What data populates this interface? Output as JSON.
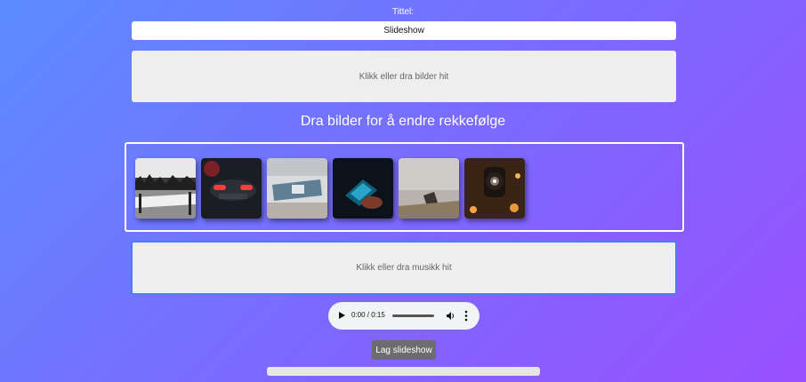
{
  "title_field": {
    "label": "Tittel:",
    "value": "Slideshow"
  },
  "image_dropzone": {
    "text": "Klikk eller dra bilder hit"
  },
  "reorder_heading": "Dra bilder for å endre rekkefølge",
  "thumbnails": [
    {
      "name": "thumbnail-winter-lake"
    },
    {
      "name": "thumbnail-car-rear"
    },
    {
      "name": "thumbnail-snow-device"
    },
    {
      "name": "thumbnail-phone-hand"
    },
    {
      "name": "thumbnail-stone-object"
    },
    {
      "name": "thumbnail-camera-lens"
    }
  ],
  "music_dropzone": {
    "text": "Klikk eller dra musikk hit"
  },
  "audio": {
    "time": "0:00 / 0:15"
  },
  "create_button": {
    "label": "Lag slideshow"
  },
  "progress": {
    "fraction": 0
  }
}
